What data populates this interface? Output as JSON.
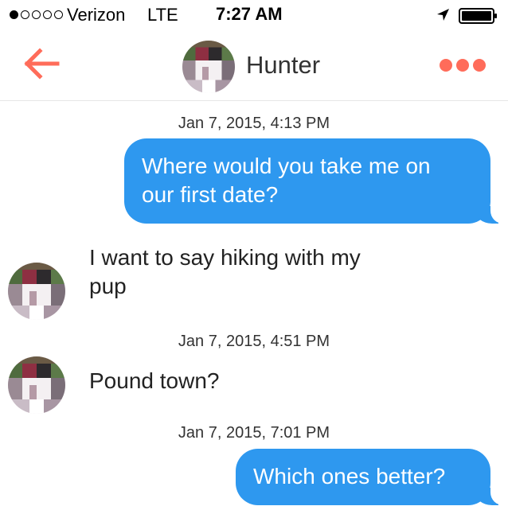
{
  "status_bar": {
    "signal_filled": 1,
    "signal_total": 5,
    "carrier": "Verizon",
    "network": "LTE",
    "time": "7:27 AM",
    "location_icon": "location-arrow-icon",
    "battery_icon": "battery-icon"
  },
  "header": {
    "back_icon": "back-arrow-icon",
    "contact_name": "Hunter",
    "more_icon": "more-options-icon",
    "accent_color": "#ff6c5a"
  },
  "messages": [
    {
      "type": "timestamp",
      "text": "Jan 7, 2015, 4:13 PM"
    },
    {
      "type": "outgoing",
      "lines": [
        "Where would you take me on",
        "our first date?"
      ]
    },
    {
      "type": "incoming",
      "lines": [
        "I want to say hiking with my",
        "pup"
      ]
    },
    {
      "type": "timestamp",
      "text": "Jan 7, 2015, 4:51 PM"
    },
    {
      "type": "incoming",
      "lines": [
        "Pound town?"
      ]
    },
    {
      "type": "timestamp",
      "text": "Jan 7, 2015, 7:01 PM"
    },
    {
      "type": "outgoing",
      "lines": [
        "Which ones better?"
      ]
    }
  ],
  "colors": {
    "outgoing_bubble": "#2e98ef",
    "outgoing_text": "#ffffff",
    "incoming_text": "#222222"
  }
}
